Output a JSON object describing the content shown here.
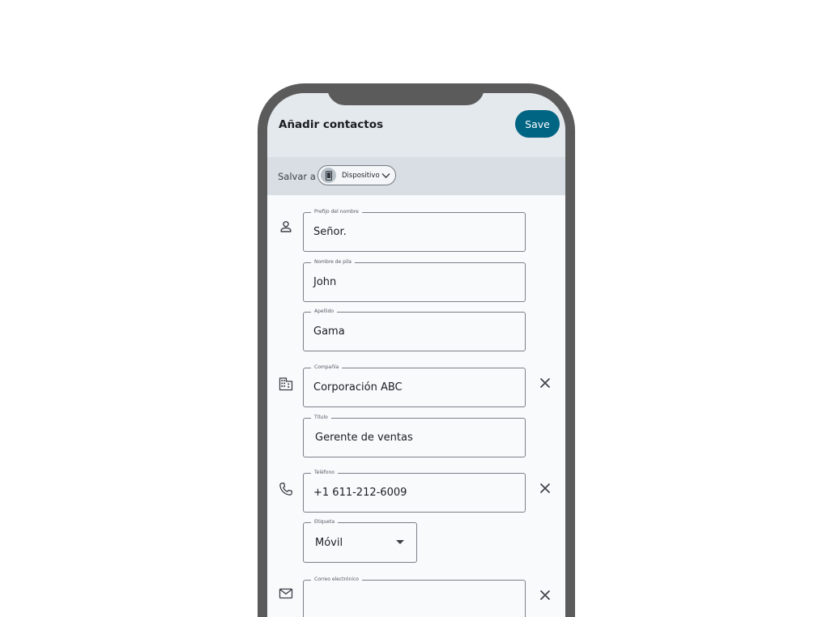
{
  "header": {
    "title": "Añadir contactos",
    "save_label": "Save"
  },
  "save_to": {
    "label": "Salvar a",
    "chip_label": "Dispositivo"
  },
  "fields": {
    "name_prefix": {
      "label": "Prefijo del nombre",
      "value": "Señor."
    },
    "first_name": {
      "label": "Nombre de pila",
      "value": "John"
    },
    "last_name": {
      "label": "Apellido",
      "value": "Gama"
    },
    "company": {
      "label": "Compañía",
      "value": "Corporación ABC"
    },
    "title": {
      "label": "Título",
      "value": "Gerente de ventas"
    },
    "phone": {
      "label": "Teléfono",
      "value": "+1 611-212-6009"
    },
    "phone_label": {
      "label": "Etiqueta",
      "value": "Móvil"
    },
    "email": {
      "label": "Correo electrónico",
      "value": ""
    }
  },
  "icons": {
    "person": "person-icon",
    "company": "building-icon",
    "phone": "phone-icon",
    "email": "mail-icon",
    "clear": "close-icon",
    "device": "smartphone-icon",
    "chevron": "chevron-down-icon"
  },
  "colors": {
    "accent": "#006483",
    "appbar": "#e4e9ee",
    "savebar": "#d8dee4",
    "phone_frame": "#5b5b5b"
  }
}
